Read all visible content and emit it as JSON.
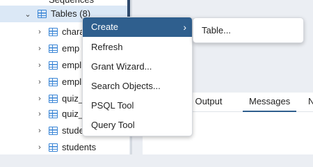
{
  "tree": {
    "items": [
      {
        "label": "Sequences",
        "type": "partial",
        "expanded": false
      },
      {
        "label": "Tables (8)",
        "type": "folder",
        "expanded": true,
        "selected": true
      },
      {
        "label": "chara",
        "type": "table"
      },
      {
        "label": "emp",
        "type": "table"
      },
      {
        "label": "empl",
        "type": "table"
      },
      {
        "label": "empl",
        "type": "table"
      },
      {
        "label": "quiz_",
        "type": "table"
      },
      {
        "label": "quiz_",
        "type": "table"
      },
      {
        "label": "stude",
        "type": "table"
      },
      {
        "label": "students",
        "type": "table"
      }
    ]
  },
  "context_menu": {
    "items": [
      {
        "label": "Create",
        "has_submenu": true,
        "active": true
      },
      {
        "label": "Refresh"
      },
      {
        "label": "Grant Wizard..."
      },
      {
        "label": "Search Objects..."
      },
      {
        "label": "PSQL Tool"
      },
      {
        "label": "Query Tool"
      }
    ]
  },
  "submenu": {
    "items": [
      {
        "label": "Table..."
      }
    ]
  },
  "tabs": {
    "items": [
      {
        "label": "ta Output"
      },
      {
        "label": "Messages",
        "active": true
      },
      {
        "label": "N"
      }
    ]
  },
  "colors": {
    "menu_active": "#2f5f8e",
    "selection": "#dbe8f6",
    "table_icon": "#3b86d6"
  },
  "icons": {
    "table": "table-icon",
    "expand": "chevron-right-icon",
    "collapse": "chevron-down-icon",
    "submenu": "chevron-right-icon"
  }
}
